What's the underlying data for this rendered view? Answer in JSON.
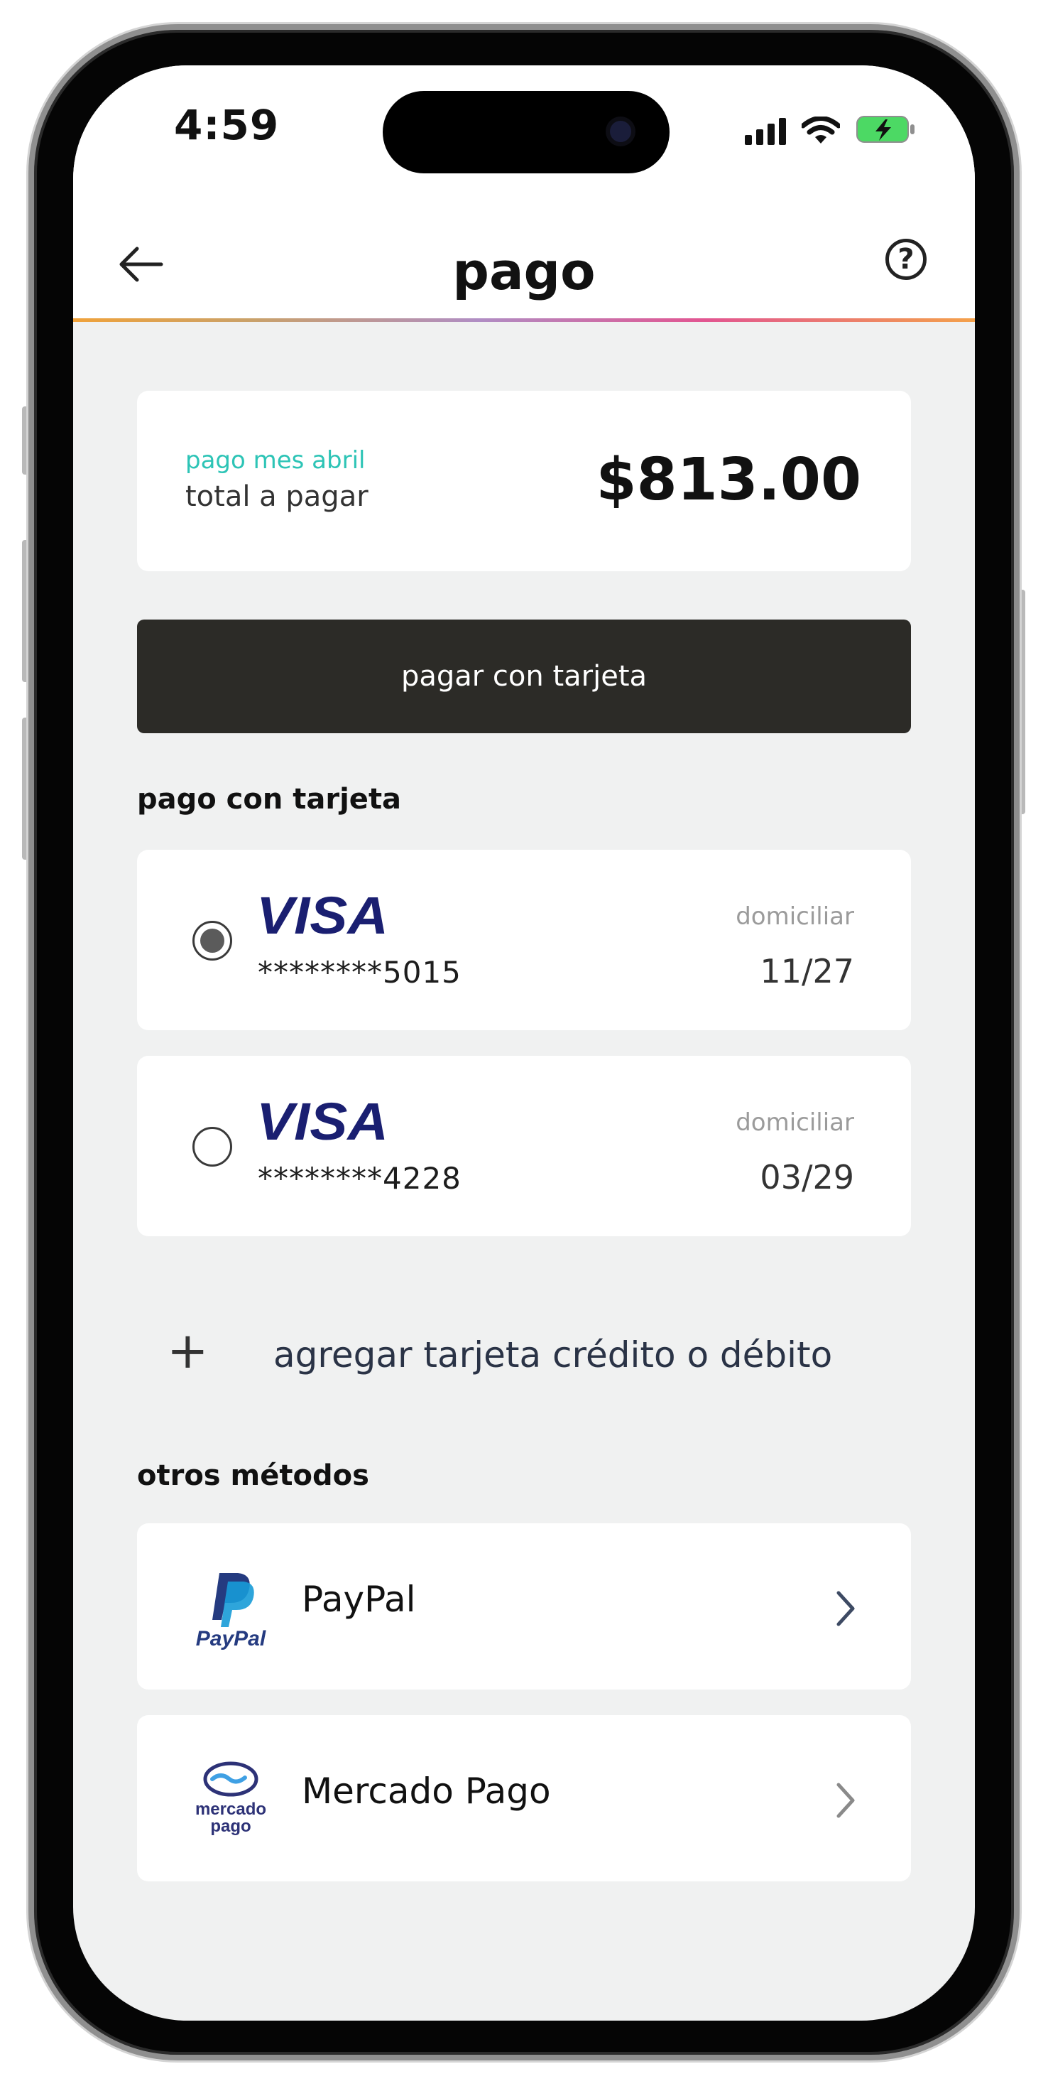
{
  "status_bar": {
    "time": "4:59"
  },
  "header": {
    "title": "pago",
    "help_icon_label": "?"
  },
  "total": {
    "period": "pago mes abril",
    "label": "total a pagar",
    "amount": "$813.00"
  },
  "pay_button": {
    "label": "pagar con tarjeta"
  },
  "card_section": {
    "title": "pago con tarjeta",
    "cards": [
      {
        "brand": "VISA",
        "number": "********5015",
        "tag": "domiciliar",
        "expiry": "11/27",
        "selected": true
      },
      {
        "brand": "VISA",
        "number": "********4228",
        "tag": "domiciliar",
        "expiry": "03/29",
        "selected": false
      }
    ],
    "add_card_icon": "+",
    "add_card_label": "agregar tarjeta crédito o débito"
  },
  "other_methods": {
    "title": "otros métodos",
    "items": [
      {
        "label": "PayPal",
        "logo_text": "PayPal",
        "icon": "paypal-logo"
      },
      {
        "label": "Mercado Pago",
        "logo_text_1": "mercado",
        "logo_text_2": "pago",
        "icon": "mercado-pago-logo"
      }
    ]
  },
  "colors": {
    "accent_teal": "#2dc4b6",
    "button_dark": "#2c2b27",
    "visa_blue": "#1a1f71",
    "paypal_dark": "#253b80",
    "paypal_light": "#179bd7",
    "mercado_navy": "#2d3277",
    "mercado_light": "#3fa0e4",
    "background": "#f0f1f1"
  }
}
